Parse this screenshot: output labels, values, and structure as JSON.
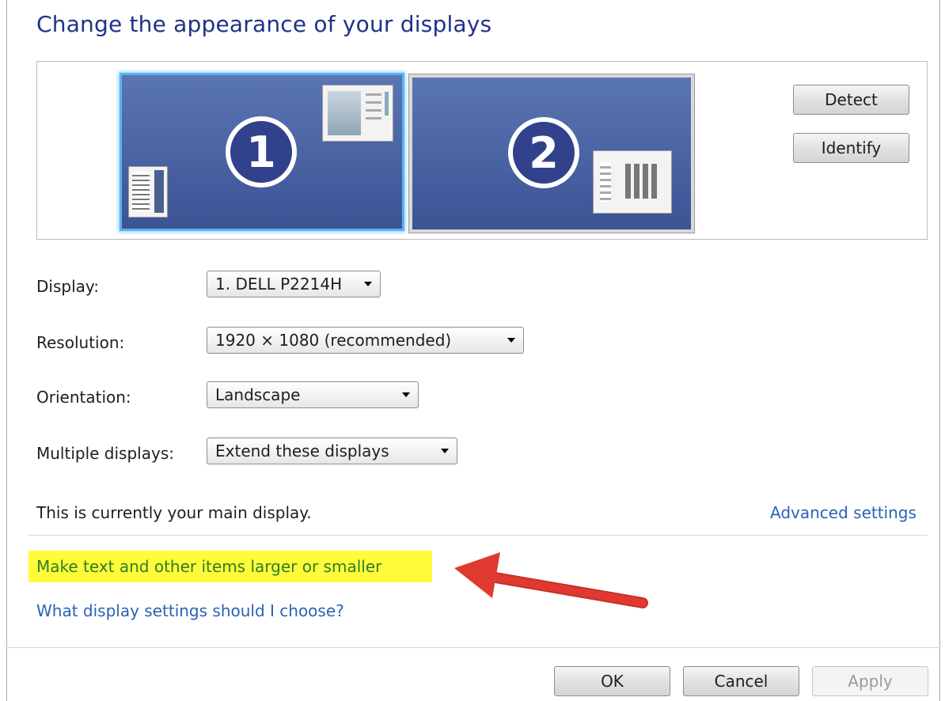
{
  "title": "Change the appearance of your displays",
  "monitors": [
    {
      "number": "1",
      "selected": true
    },
    {
      "number": "2",
      "selected": false
    }
  ],
  "buttons": {
    "detect": "Detect",
    "identify": "Identify",
    "ok": "OK",
    "cancel": "Cancel",
    "apply": "Apply"
  },
  "fields": {
    "display": {
      "label": "Display:",
      "value": "1. DELL P2214H"
    },
    "resolution": {
      "label": "Resolution:",
      "value": "1920 × 1080 (recommended)"
    },
    "orientation": {
      "label": "Orientation:",
      "value": "Landscape"
    },
    "multiple_displays": {
      "label": "Multiple displays:",
      "value": "Extend these displays"
    }
  },
  "status_text": "This is currently your main display.",
  "links": {
    "advanced": "Advanced settings",
    "text_size": "Make text and other items larger or smaller",
    "help": "What display settings should I choose?"
  },
  "colors": {
    "title": "#1e3287",
    "link": "#2a62b4",
    "highlight": "#fffb3a",
    "arrow": "#e03a30"
  },
  "annotation": {
    "arrow": "red-arrow pointing to highlighted link"
  }
}
